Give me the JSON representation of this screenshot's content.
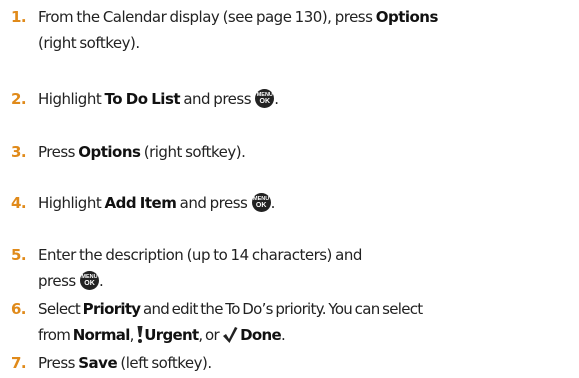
{
  "key_label": {
    "top": "MENU",
    "bottom": "OK"
  },
  "steps": [
    {
      "number": "1.",
      "line1_text": "From the Calendar display (see page 130), press ",
      "line1_bold": "Options",
      "line2_text": "(right softkey)."
    },
    {
      "number": "2.",
      "pre": "Highlight ",
      "bold": "To Do List",
      "post": " and press "
    },
    {
      "number": "3.",
      "pre": "Press ",
      "bold": "Options",
      "post": " (right softkey)."
    },
    {
      "number": "4.",
      "pre": "Highlight ",
      "bold": "Add Item",
      "post": " and press "
    },
    {
      "number": "5.",
      "line1_text": "Enter the description (up to 14 characters) and",
      "line2_text": "press "
    },
    {
      "number": "6.",
      "line1_pre": "Select ",
      "line1_bold": "Priority",
      "line1_post": " and edit the To Do’s priority. You can select",
      "line2_pre": "from ",
      "option_normal": "Normal",
      "option_urgent": "Urgent",
      "option_done": "Done",
      "sep1": ", ",
      "sep2": ", or "
    },
    {
      "number": "7.",
      "pre": "Press ",
      "bold": "Save",
      "post": " (left softkey)."
    }
  ]
}
